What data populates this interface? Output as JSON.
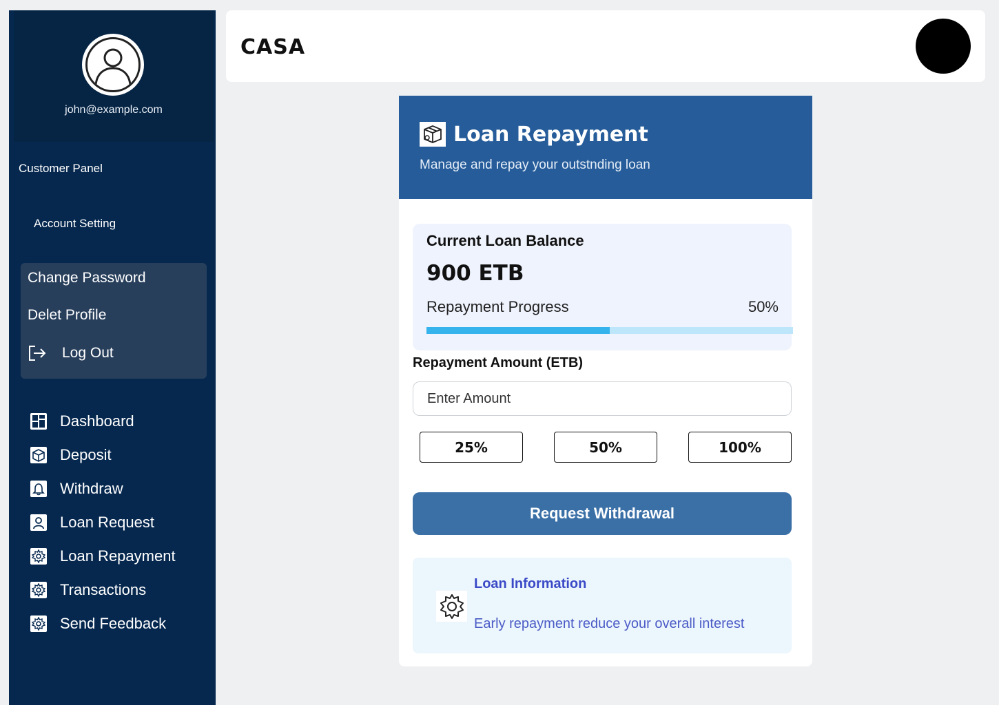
{
  "sidebar": {
    "email": "john@example.com",
    "panel_title": "Customer Panel",
    "account_setting": "Account Setting",
    "submenu": {
      "change_password": "Change Password",
      "delete_profile": "Delet Profile",
      "log_out": "Log Out"
    },
    "nav": [
      {
        "label": "Dashboard",
        "icon": "dashboard-icon"
      },
      {
        "label": "Deposit",
        "icon": "deposit-icon"
      },
      {
        "label": "Withdraw",
        "icon": "bell-icon"
      },
      {
        "label": "Loan Request",
        "icon": "user-icon"
      },
      {
        "label": "Loan Repayment",
        "icon": "gear-icon"
      },
      {
        "label": "Transactions",
        "icon": "gear-icon"
      },
      {
        "label": "Send Feedback",
        "icon": "gear-icon"
      }
    ]
  },
  "header": {
    "brand": "CASA"
  },
  "card": {
    "title": "Loan Repayment",
    "subtitle": "Manage and repay your outstnding loan",
    "balance": {
      "label": "Current Loan Balance",
      "value": "900 ETB",
      "progress_label": "Repayment Progress",
      "progress_pct_text": "50%",
      "progress_fraction": 0.5
    },
    "amount": {
      "label": "Repayment Amount (ETB)",
      "placeholder": "Enter Amount"
    },
    "quick_buttons": [
      "25%",
      "50%",
      "100%"
    ],
    "submit_label": "Request Withdrawal",
    "info": {
      "title": "Loan Information",
      "text": "Early repayment reduce your overall interest"
    }
  },
  "colors": {
    "sidebar_bg": "#06284f",
    "header_bar": "#255c99",
    "primary_button": "#3b70a7",
    "progress_fill": "#34b3ec",
    "progress_track": "#bde6fb",
    "info_accent": "#3a4ac7"
  }
}
